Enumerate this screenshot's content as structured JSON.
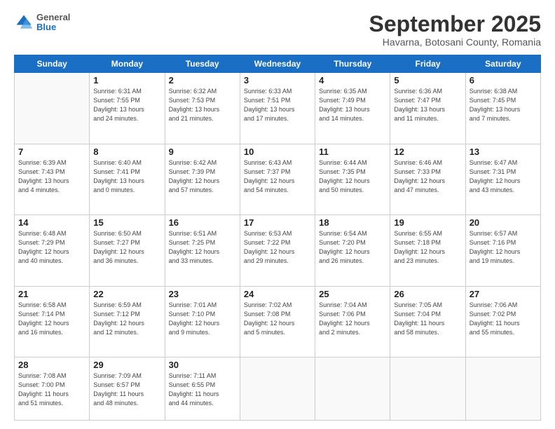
{
  "header": {
    "logo": {
      "general": "General",
      "blue": "Blue"
    },
    "title": "September 2025",
    "subtitle": "Havarna, Botosani County, Romania"
  },
  "weekdays": [
    "Sunday",
    "Monday",
    "Tuesday",
    "Wednesday",
    "Thursday",
    "Friday",
    "Saturday"
  ],
  "weeks": [
    [
      {
        "day": "",
        "info": ""
      },
      {
        "day": "1",
        "info": "Sunrise: 6:31 AM\nSunset: 7:55 PM\nDaylight: 13 hours\nand 24 minutes."
      },
      {
        "day": "2",
        "info": "Sunrise: 6:32 AM\nSunset: 7:53 PM\nDaylight: 13 hours\nand 21 minutes."
      },
      {
        "day": "3",
        "info": "Sunrise: 6:33 AM\nSunset: 7:51 PM\nDaylight: 13 hours\nand 17 minutes."
      },
      {
        "day": "4",
        "info": "Sunrise: 6:35 AM\nSunset: 7:49 PM\nDaylight: 13 hours\nand 14 minutes."
      },
      {
        "day": "5",
        "info": "Sunrise: 6:36 AM\nSunset: 7:47 PM\nDaylight: 13 hours\nand 11 minutes."
      },
      {
        "day": "6",
        "info": "Sunrise: 6:38 AM\nSunset: 7:45 PM\nDaylight: 13 hours\nand 7 minutes."
      }
    ],
    [
      {
        "day": "7",
        "info": "Sunrise: 6:39 AM\nSunset: 7:43 PM\nDaylight: 13 hours\nand 4 minutes."
      },
      {
        "day": "8",
        "info": "Sunrise: 6:40 AM\nSunset: 7:41 PM\nDaylight: 13 hours\nand 0 minutes."
      },
      {
        "day": "9",
        "info": "Sunrise: 6:42 AM\nSunset: 7:39 PM\nDaylight: 12 hours\nand 57 minutes."
      },
      {
        "day": "10",
        "info": "Sunrise: 6:43 AM\nSunset: 7:37 PM\nDaylight: 12 hours\nand 54 minutes."
      },
      {
        "day": "11",
        "info": "Sunrise: 6:44 AM\nSunset: 7:35 PM\nDaylight: 12 hours\nand 50 minutes."
      },
      {
        "day": "12",
        "info": "Sunrise: 6:46 AM\nSunset: 7:33 PM\nDaylight: 12 hours\nand 47 minutes."
      },
      {
        "day": "13",
        "info": "Sunrise: 6:47 AM\nSunset: 7:31 PM\nDaylight: 12 hours\nand 43 minutes."
      }
    ],
    [
      {
        "day": "14",
        "info": "Sunrise: 6:48 AM\nSunset: 7:29 PM\nDaylight: 12 hours\nand 40 minutes."
      },
      {
        "day": "15",
        "info": "Sunrise: 6:50 AM\nSunset: 7:27 PM\nDaylight: 12 hours\nand 36 minutes."
      },
      {
        "day": "16",
        "info": "Sunrise: 6:51 AM\nSunset: 7:25 PM\nDaylight: 12 hours\nand 33 minutes."
      },
      {
        "day": "17",
        "info": "Sunrise: 6:53 AM\nSunset: 7:22 PM\nDaylight: 12 hours\nand 29 minutes."
      },
      {
        "day": "18",
        "info": "Sunrise: 6:54 AM\nSunset: 7:20 PM\nDaylight: 12 hours\nand 26 minutes."
      },
      {
        "day": "19",
        "info": "Sunrise: 6:55 AM\nSunset: 7:18 PM\nDaylight: 12 hours\nand 23 minutes."
      },
      {
        "day": "20",
        "info": "Sunrise: 6:57 AM\nSunset: 7:16 PM\nDaylight: 12 hours\nand 19 minutes."
      }
    ],
    [
      {
        "day": "21",
        "info": "Sunrise: 6:58 AM\nSunset: 7:14 PM\nDaylight: 12 hours\nand 16 minutes."
      },
      {
        "day": "22",
        "info": "Sunrise: 6:59 AM\nSunset: 7:12 PM\nDaylight: 12 hours\nand 12 minutes."
      },
      {
        "day": "23",
        "info": "Sunrise: 7:01 AM\nSunset: 7:10 PM\nDaylight: 12 hours\nand 9 minutes."
      },
      {
        "day": "24",
        "info": "Sunrise: 7:02 AM\nSunset: 7:08 PM\nDaylight: 12 hours\nand 5 minutes."
      },
      {
        "day": "25",
        "info": "Sunrise: 7:04 AM\nSunset: 7:06 PM\nDaylight: 12 hours\nand 2 minutes."
      },
      {
        "day": "26",
        "info": "Sunrise: 7:05 AM\nSunset: 7:04 PM\nDaylight: 11 hours\nand 58 minutes."
      },
      {
        "day": "27",
        "info": "Sunrise: 7:06 AM\nSunset: 7:02 PM\nDaylight: 11 hours\nand 55 minutes."
      }
    ],
    [
      {
        "day": "28",
        "info": "Sunrise: 7:08 AM\nSunset: 7:00 PM\nDaylight: 11 hours\nand 51 minutes."
      },
      {
        "day": "29",
        "info": "Sunrise: 7:09 AM\nSunset: 6:57 PM\nDaylight: 11 hours\nand 48 minutes."
      },
      {
        "day": "30",
        "info": "Sunrise: 7:11 AM\nSunset: 6:55 PM\nDaylight: 11 hours\nand 44 minutes."
      },
      {
        "day": "",
        "info": ""
      },
      {
        "day": "",
        "info": ""
      },
      {
        "day": "",
        "info": ""
      },
      {
        "day": "",
        "info": ""
      }
    ]
  ]
}
